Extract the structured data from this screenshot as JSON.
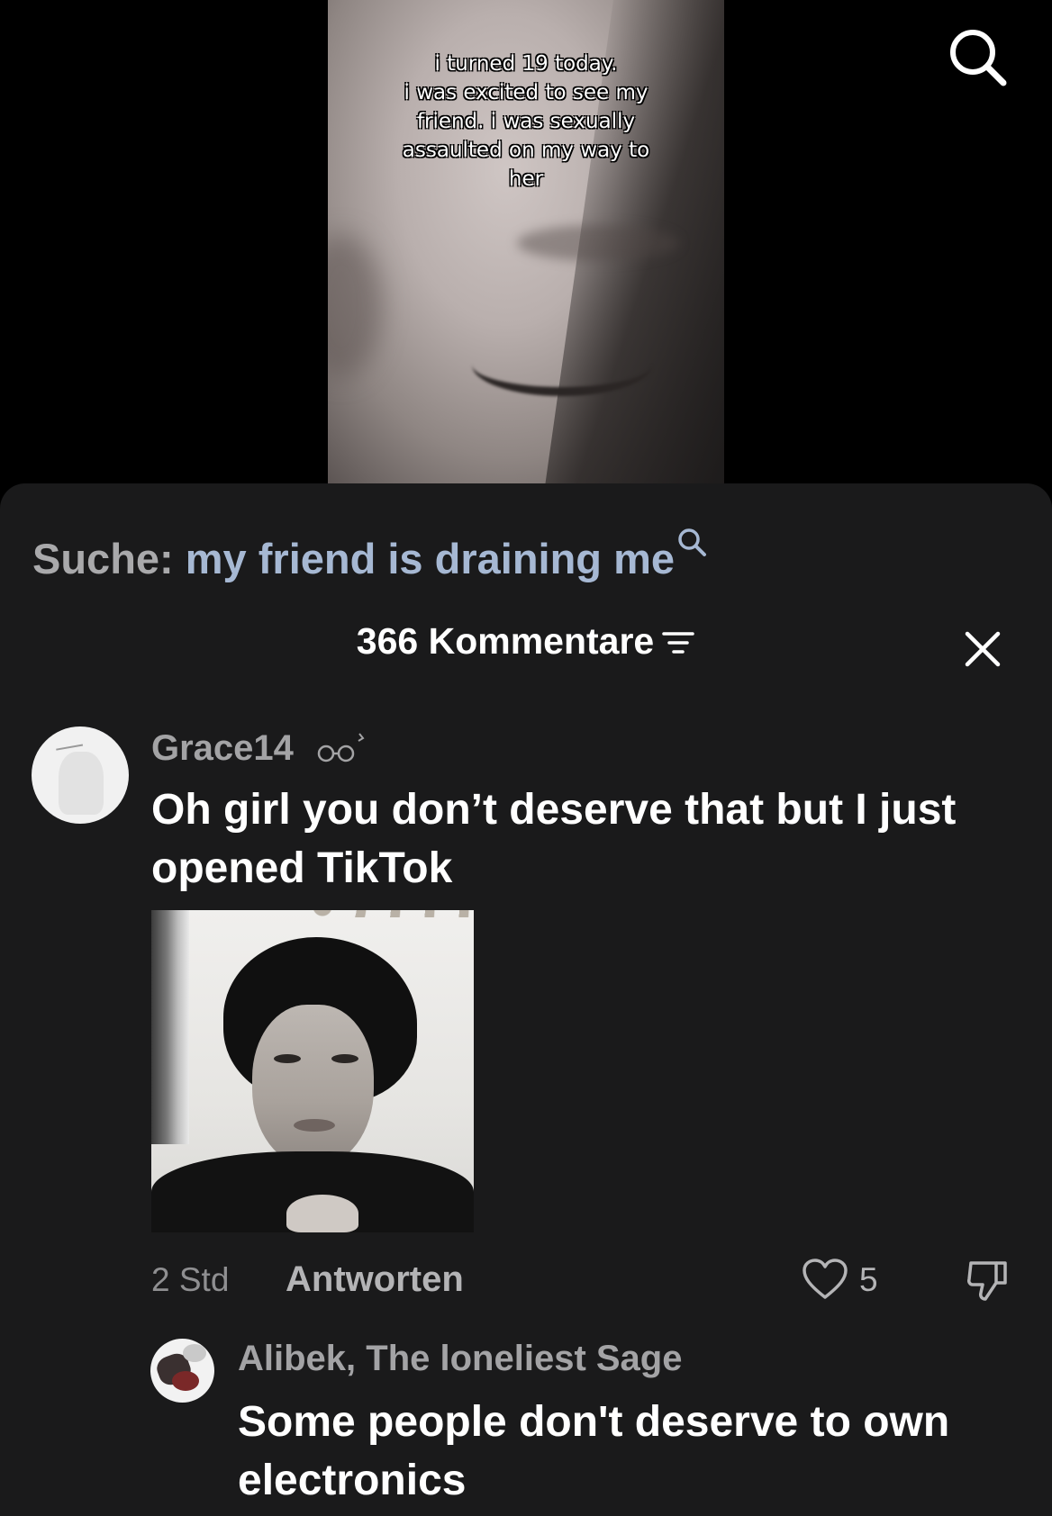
{
  "video": {
    "caption_lines": [
      "i turned 19 today.",
      "i was excited to see my",
      "friend. i was sexually",
      "assaulted on my way to",
      "her"
    ]
  },
  "search": {
    "label": "Suche:",
    "query": "my friend is draining me"
  },
  "comments": {
    "header": "366 Kommentare",
    "items": [
      {
        "username": "Grace14",
        "text": "Oh girl you don’t deserve that but I just opened TikTok",
        "time": "2 Std",
        "reply_label": "Antworten",
        "likes": "5"
      }
    ],
    "reply": {
      "username": "Alibek, The loneliest Sage",
      "text": "Some people don't deserve to own electronics"
    }
  },
  "icons": {
    "top_right": "search-icon",
    "header_filter": "filter-icon",
    "header_close": "close-icon",
    "like": "heart-icon",
    "dislike": "thumbs-down-icon"
  },
  "colors": {
    "background": "#000000",
    "sheet": "#1a1a1b",
    "search_query": "#a6b8d3",
    "muted_text": "#a3a3a5"
  }
}
